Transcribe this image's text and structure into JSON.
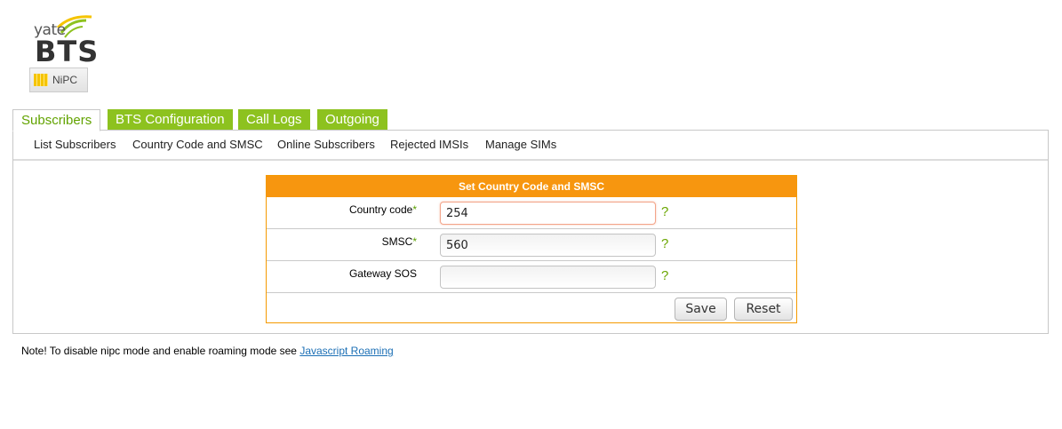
{
  "logo": {
    "top_text": "yate",
    "main_text": "BTS",
    "badge_text": "NiPC"
  },
  "tabs": [
    {
      "label": "Subscribers",
      "active": true
    },
    {
      "label": "BTS Configuration",
      "active": false
    },
    {
      "label": "Call Logs",
      "active": false
    },
    {
      "label": "Outgoing",
      "active": false
    }
  ],
  "subnav": [
    {
      "label": "List Subscribers"
    },
    {
      "label": "Country Code and SMSC"
    },
    {
      "label": "Online Subscribers"
    },
    {
      "label": "Rejected IMSIs"
    },
    {
      "label": "Manage SIMs"
    }
  ],
  "form": {
    "title": "Set Country Code and SMSC",
    "required_mark": "*",
    "help_mark": "?",
    "fields": [
      {
        "label": "Country code",
        "required": true,
        "value": "254"
      },
      {
        "label": "SMSC",
        "required": true,
        "value": "560"
      },
      {
        "label": "Gateway SOS",
        "required": false,
        "value": ""
      }
    ],
    "save_label": "Save",
    "reset_label": "Reset"
  },
  "note": {
    "text": "Note! To disable nipc mode and enable roaming mode see ",
    "link": "Javascript Roaming"
  },
  "colors": {
    "accent_green": "#8dc21f",
    "header_orange": "#f7960f",
    "link_blue": "#1b6fb5"
  }
}
